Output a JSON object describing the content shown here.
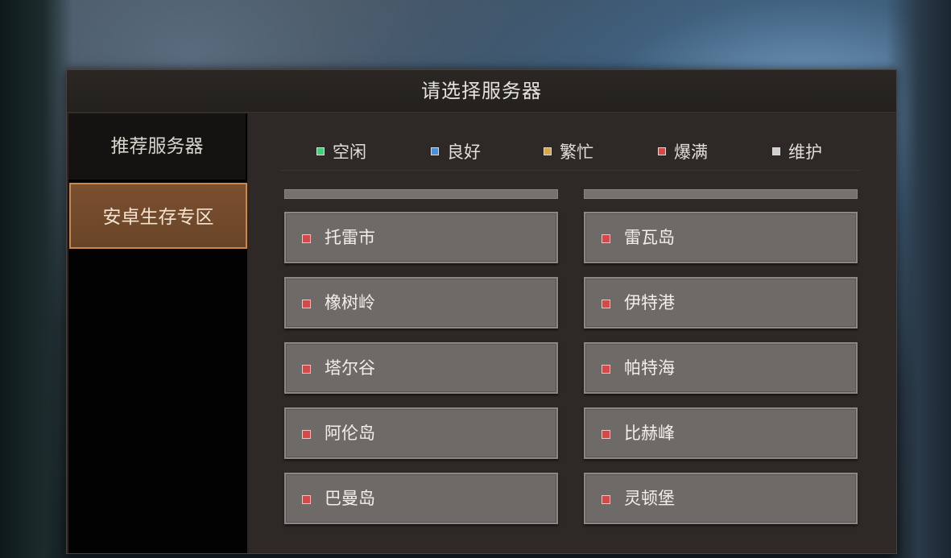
{
  "dialog": {
    "title": "请选择服务器"
  },
  "sidebar": {
    "tabs": [
      {
        "label": "推荐服务器"
      },
      {
        "label": "安卓生存专区"
      }
    ]
  },
  "legend": [
    {
      "label": "空闲",
      "color": "#3fd17a"
    },
    {
      "label": "良好",
      "color": "#4a8fd8"
    },
    {
      "label": "繁忙",
      "color": "#d9a64a"
    },
    {
      "label": "爆满",
      "color": "#d24a4a"
    },
    {
      "label": "维护",
      "color": "#cfcfcf"
    }
  ],
  "servers": {
    "left": [
      {
        "name": "托雷市",
        "status": "爆满"
      },
      {
        "name": "橡树岭",
        "status": "爆满"
      },
      {
        "name": "塔尔谷",
        "status": "爆满"
      },
      {
        "name": "阿伦岛",
        "status": "爆满"
      },
      {
        "name": "巴曼岛",
        "status": "爆满"
      }
    ],
    "right": [
      {
        "name": "雷瓦岛",
        "status": "爆满"
      },
      {
        "name": "伊特港",
        "status": "爆满"
      },
      {
        "name": "帕特海",
        "status": "爆满"
      },
      {
        "name": "比赫峰",
        "status": "爆满"
      },
      {
        "name": "灵顿堡",
        "status": "爆满"
      }
    ]
  },
  "colors": {
    "full": "#d24a4a",
    "active_tab": "#7a5030",
    "active_tab_border": "#c9884d"
  }
}
